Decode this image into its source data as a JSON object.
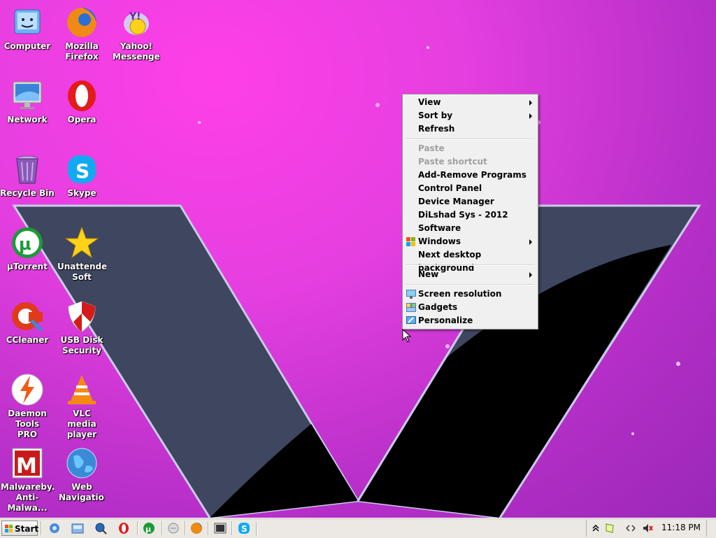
{
  "desktop": {
    "icons": [
      {
        "label": "Computer",
        "icon": "computer-icon"
      },
      {
        "label": "Mozilla Firefox",
        "icon": "firefox-icon"
      },
      {
        "label": "Yahoo! Messenger",
        "icon": "yahoo-messenger-icon"
      },
      {
        "label": "Network",
        "icon": "network-icon"
      },
      {
        "label": "Opera",
        "icon": "opera-icon"
      },
      {
        "label": "Recycle Bin",
        "icon": "recycle-bin-icon"
      },
      {
        "label": "Skype",
        "icon": "skype-icon"
      },
      {
        "label": "µTorrent",
        "icon": "utorrent-icon"
      },
      {
        "label": "Unattended Soft",
        "icon": "star-icon"
      },
      {
        "label": "CCleaner",
        "icon": "ccleaner-icon"
      },
      {
        "label": "USB Disk Security",
        "icon": "shield-icon"
      },
      {
        "label": "Daemon Tools PRO",
        "icon": "daemon-tools-icon"
      },
      {
        "label": "VLC media player",
        "icon": "vlc-icon"
      },
      {
        "label": "Malwareby... Anti-Malwa...",
        "icon": "malwarebytes-icon"
      },
      {
        "label": "Web Navigation",
        "icon": "globe-icon"
      }
    ]
  },
  "context_menu": {
    "items": {
      "view": "View",
      "sort_by": "Sort by",
      "refresh": "Refresh",
      "paste": "Paste",
      "paste_shortcut": "Paste shortcut",
      "add_remove": "Add-Remove Programs",
      "control_panel": "Control Panel",
      "device_manager": "Device Manager",
      "dilshad": "DiLshad Sys - 2012",
      "software": "Software",
      "windows": "Windows",
      "next_bg": "Next desktop background",
      "new": "New",
      "screen_res": "Screen resolution",
      "gadgets": "Gadgets",
      "personalize": "Personalize"
    }
  },
  "taskbar": {
    "start_label": "Start",
    "quick_launch": [
      "ie-icon",
      "explorer-icon",
      "search-icon",
      "opera-icon",
      "utorrent-icon",
      "media-icon",
      "firefox-icon",
      "terminal-icon",
      "skype-icon"
    ],
    "tray": [
      "show-hidden-icons",
      "notification-icon",
      "network-arrows-icon",
      "volume-muted-icon"
    ],
    "clock": "11:18 PM"
  },
  "colors": {
    "wallpaper_magenta": "#e53fe0",
    "wallpaper_purple": "#9a28b8",
    "v_slate": "#3e4660",
    "v_black": "#000000",
    "menu_bg": "#f0f0f0",
    "taskbar_bg": "#ece9e4"
  }
}
